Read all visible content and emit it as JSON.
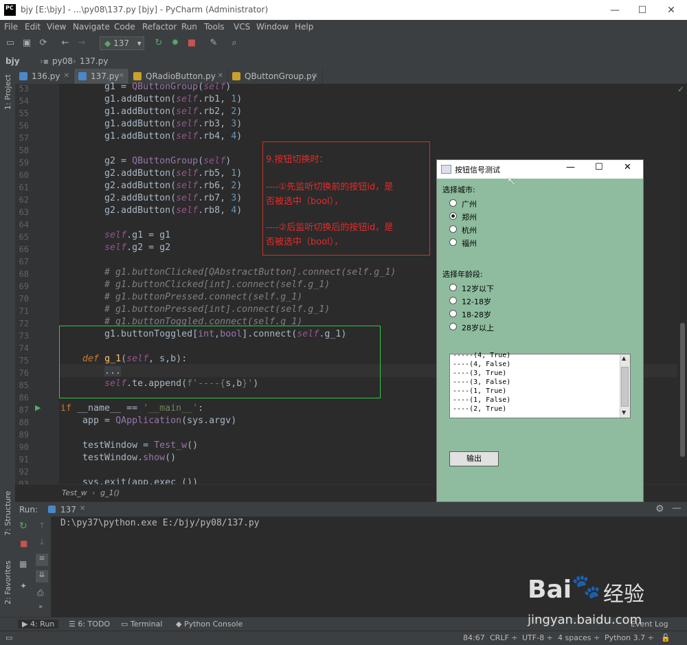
{
  "window": {
    "title": "bjy [E:\\bjy] - ...\\py08\\137.py [bjy] - PyCharm (Administrator)",
    "logo": "PC"
  },
  "menu": [
    "File",
    "Edit",
    "View",
    "Navigate",
    "Code",
    "Refactor",
    "Run",
    "Tools",
    "VCS",
    "Window",
    "Help"
  ],
  "toolbar": {
    "run_config": "137"
  },
  "nav": {
    "project": "bjy",
    "folder": "py08",
    "file": "137.py"
  },
  "tabs": [
    {
      "label": "136.py"
    },
    {
      "label": "137.py"
    },
    {
      "label": "QRadioButton.py"
    },
    {
      "label": "QButtonGroup.py"
    }
  ],
  "side_tabs": {
    "project": "1: Project",
    "structure": "7: Structure",
    "favorites": "2: Favorites"
  },
  "code_lines": [
    {
      "n": "53",
      "t": "g1 = QButtonGroup(self)"
    },
    {
      "n": "54",
      "t": "g1.addButton(self.rb1, 1)"
    },
    {
      "n": "55",
      "t": "g1.addButton(self.rb2, 2)"
    },
    {
      "n": "56",
      "t": "g1.addButton(self.rb3, 3)"
    },
    {
      "n": "57",
      "t": "g1.addButton(self.rb4, 4)"
    },
    {
      "n": "58",
      "t": ""
    },
    {
      "n": "59",
      "t": "g2 = QButtonGroup(self)"
    },
    {
      "n": "60",
      "t": "g2.addButton(self.rb5, 1)"
    },
    {
      "n": "61",
      "t": "g2.addButton(self.rb6, 2)"
    },
    {
      "n": "62",
      "t": "g2.addButton(self.rb7, 3)"
    },
    {
      "n": "63",
      "t": "g2.addButton(self.rb8, 4)"
    },
    {
      "n": "64",
      "t": ""
    },
    {
      "n": "65",
      "t": "self.g1 = g1"
    },
    {
      "n": "66",
      "t": "self.g2 = g2"
    },
    {
      "n": "67",
      "t": ""
    },
    {
      "n": "68",
      "t": "# g1.buttonClicked[QAbstractButton].connect(self.g_1)"
    },
    {
      "n": "69",
      "t": "# g1.buttonClicked[int].connect(self.g_1)"
    },
    {
      "n": "70",
      "t": "# g1.buttonPressed.connect(self.g_1)"
    },
    {
      "n": "71",
      "t": "# g1.buttonPressed[int].connect(self.g_1)"
    },
    {
      "n": "72",
      "t": "# g1.buttonToggled.connect(self.g_1)"
    },
    {
      "n": "73",
      "t": "g1.buttonToggled[int,bool].connect(self.g_1)"
    },
    {
      "n": "74",
      "t": ""
    },
    {
      "n": "75",
      "t": "def g_1(self, s,b):"
    },
    {
      "n": "76",
      "t": "..."
    },
    {
      "n": "85",
      "t": "self.te.append(f'----{s,b}')"
    },
    {
      "n": "86",
      "t": ""
    },
    {
      "n": "87",
      "t": "if __name__ == '__main__':"
    },
    {
      "n": "88",
      "t": "app = QApplication(sys.argv)"
    },
    {
      "n": "89",
      "t": ""
    },
    {
      "n": "90",
      "t": "testWindow = Test_w()"
    },
    {
      "n": "91",
      "t": "testWindow.show()"
    },
    {
      "n": "92",
      "t": ""
    },
    {
      "n": "93",
      "t": "sys.exit(app.exec_())"
    }
  ],
  "editor_breadcrumb": {
    "cls": "Test_w",
    "method": "g_1()"
  },
  "annotation": {
    "l1": "9.按钮切换时：",
    "l2": "----①先监听切换前的按钮id，是",
    "l3": "否被选中（bool），",
    "l4": "----②后监听切换后的按钮id，是",
    "l5": "否被选中（bool），"
  },
  "run": {
    "label": "Run:",
    "tab": "137",
    "command": "D:\\py37\\python.exe E:/bjy/py08/137.py"
  },
  "qt": {
    "title": "按钮信号测试",
    "city_label": "选择城市:",
    "cities": [
      "广州",
      "郑州",
      "杭州",
      "福州"
    ],
    "age_label": "选择年龄段:",
    "ages": [
      "12岁以下",
      "12-18岁",
      "18-28岁",
      "28岁以上"
    ],
    "log": [
      "-----(4, True)",
      "----(4, False)",
      "----(3, True)",
      "----(3, False)",
      "----(1, True)",
      "----(1, False)",
      "----(2, True)"
    ],
    "output_button": "输出"
  },
  "bottom_tabs": [
    "4: Run",
    "6: TODO",
    "Terminal",
    "Python Console",
    "Event Log"
  ],
  "status": {
    "pos": "84:67",
    "crlf": "CRLF ÷",
    "enc": "UTF-8 ÷",
    "indent": "4 spaces ÷",
    "interp": "Python 3.7 ÷"
  },
  "watermark": {
    "brand": "Bai",
    "brand2": "经验",
    "url": "jingyan.baidu.com"
  }
}
